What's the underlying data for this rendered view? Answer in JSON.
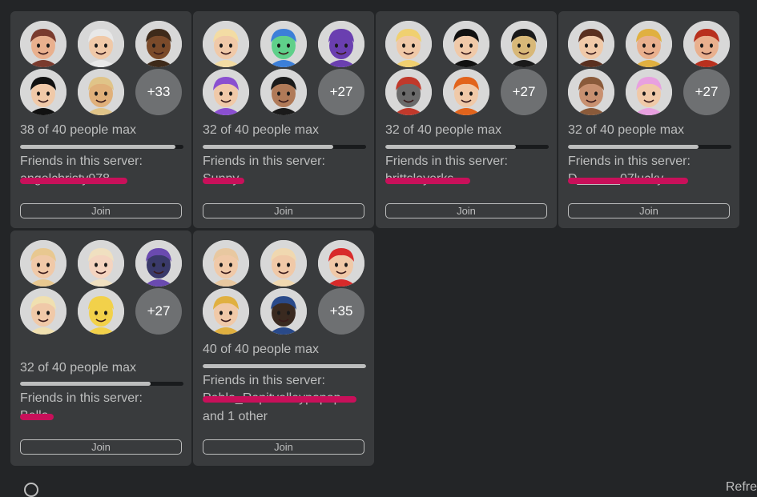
{
  "servers": [
    {
      "avatar_colors": [
        {
          "skin": "#e9b08e",
          "hair": "#7a3b2e",
          "bg": "#d8d8d8"
        },
        {
          "skin": "#f0c9a8",
          "hair": "#e8e8e8",
          "bg": "#d8d8d8"
        },
        {
          "skin": "#7a4a2a",
          "hair": "#3e2a1a",
          "bg": "#d8d8d8"
        },
        {
          "skin": "#f0c9a8",
          "hair": "#111111",
          "bg": "#d8d8d8"
        },
        {
          "skin": "#e0b07a",
          "hair": "#e0c488",
          "bg": "#d8d8d8"
        }
      ],
      "more": "+33",
      "capacity": "38 of 40 people max",
      "fill": 0.95,
      "friends_label": "Friends in this server:",
      "friend_name": "angelchristy978",
      "other": "",
      "join_label": "Join"
    },
    {
      "avatar_colors": [
        {
          "skin": "#f0c9a8",
          "hair": "#f3dca4",
          "bg": "#d8d8d8"
        },
        {
          "skin": "#5fd08a",
          "hair": "#3c7fd8",
          "bg": "#d8d8d8"
        },
        {
          "skin": "#6a3fb0",
          "hair": "#6a3fb0",
          "bg": "#d8d8d8"
        },
        {
          "skin": "#f0c9a8",
          "hair": "#8a4fd0",
          "bg": "#d8d8d8"
        },
        {
          "skin": "#b07a58",
          "hair": "#1a1a1a",
          "bg": "#d8d8d8"
        }
      ],
      "more": "+27",
      "capacity": "32 of 40 people max",
      "fill": 0.8,
      "friends_label": "Friends in this server:",
      "friend_name": "Sunny",
      "other": "",
      "join_label": "Join"
    },
    {
      "avatar_colors": [
        {
          "skin": "#f0c9a8",
          "hair": "#f0d070",
          "bg": "#d8d8d8"
        },
        {
          "skin": "#f0c9a8",
          "hair": "#111111",
          "bg": "#d8d8d8"
        },
        {
          "skin": "#d8b878",
          "hair": "#1a1a1a",
          "bg": "#d8d8d8"
        },
        {
          "skin": "#6a6a6a",
          "hair": "#c0392b",
          "bg": "#d8d8d8"
        },
        {
          "skin": "#f0c9a8",
          "hair": "#e2641c",
          "bg": "#d8d8d8"
        }
      ],
      "more": "+27",
      "capacity": "32 of 40 people max",
      "fill": 0.8,
      "friends_label": "Friends in this server:",
      "friend_name": "brittslayerks",
      "other": "",
      "join_label": "Join"
    },
    {
      "avatar_colors": [
        {
          "skin": "#f0c9a8",
          "hair": "#5a3020",
          "bg": "#d8d8d8"
        },
        {
          "skin": "#e9b08e",
          "hair": "#e0b040",
          "bg": "#d8d8d8"
        },
        {
          "skin": "#e9b08e",
          "hair": "#b8301e",
          "bg": "#d8d8d8"
        },
        {
          "skin": "#c89070",
          "hair": "#8a5a3a",
          "bg": "#d8d8d8"
        },
        {
          "skin": "#f0c9a8",
          "hair": "#e8a0e0",
          "bg": "#d8d8d8"
        }
      ],
      "more": "+27",
      "capacity": "32 of 40 people max",
      "fill": 0.8,
      "friends_label": "Friends in this server:",
      "friend_name": "D______07lucky",
      "other": "",
      "join_label": "Join"
    },
    {
      "avatar_colors": [
        {
          "skin": "#f0c9a8",
          "hair": "#e8c890",
          "bg": "#d8d8d8"
        },
        {
          "skin": "#f4d4c0",
          "hair": "#f0e0c0",
          "bg": "#d8d8d8"
        },
        {
          "skin": "#3a3a6a",
          "hair": "#6a4ab0",
          "bg": "#d8d8d8"
        },
        {
          "skin": "#f0c9a8",
          "hair": "#f0e0b0",
          "bg": "#d8d8d8"
        },
        {
          "skin": "#f2d14a",
          "hair": "#f2d14a",
          "bg": "#d8d8d8"
        }
      ],
      "more": "+27",
      "capacity": "32 of 40 people max",
      "fill": 0.8,
      "friends_label": "Friends in this server:",
      "friend_name": "Bella",
      "other": "",
      "join_label": "Join"
    },
    {
      "avatar_colors": [
        {
          "skin": "#f0c9a8",
          "hair": "#e8c8a0",
          "bg": "#d8d8d8"
        },
        {
          "skin": "#f0c9a8",
          "hair": "#f0d8b0",
          "bg": "#d8d8d8"
        },
        {
          "skin": "#f0c9a8",
          "hair": "#d82a2a",
          "bg": "#d8d8d8"
        },
        {
          "skin": "#f0c9a8",
          "hair": "#e0b040",
          "bg": "#d8d8d8"
        },
        {
          "skin": "#3a2a20",
          "hair": "#2a4a8a",
          "bg": "#d8d8d8"
        }
      ],
      "more": "+35",
      "capacity": "40 of 40 people max",
      "fill": 1.0,
      "friends_label": "Friends in this server:",
      "friend_name": "Pablo_Rapitvolleypopop",
      "other": "and 1 other",
      "join_label": "Join"
    }
  ],
  "footer": {
    "refresh_label": "Refre"
  }
}
